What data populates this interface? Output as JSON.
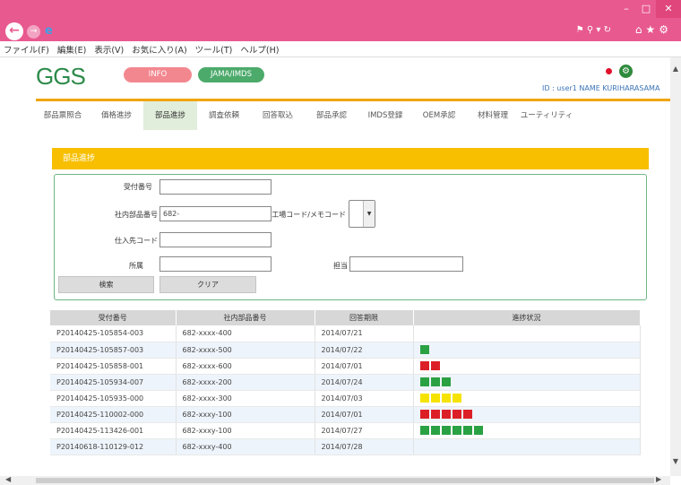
{
  "menubar": [
    "ファイル(F)",
    "編集(E)",
    "表示(V)",
    "お気に入り(A)",
    "ツール(T)",
    "ヘルプ(H)"
  ],
  "header": {
    "logo": "GGS",
    "info_button": "INFO",
    "jama_button": "JAMA/IMDS",
    "user_id": "ID : user1 NAME KURIHARASAMA"
  },
  "tabs": [
    "部品票照合",
    "価格進捗",
    "部品進捗",
    "調査依頼",
    "回答取込",
    "部品承認",
    "IMDS登録",
    "OEM承認",
    "材料管理",
    "ユーティリティ"
  ],
  "active_tab": 2,
  "panel": {
    "title": "部品進捗"
  },
  "form": {
    "receipt_no_label": "受付番号",
    "receipt_no_value": "",
    "part_no_label": "社内部品番号",
    "part_no_value": "682-",
    "factory_code_label": "工場コード/メモコード",
    "supplier_code_label": "仕入先コード",
    "supplier_code_value": "",
    "dept_label": "所属",
    "dept_value": "",
    "person_label": "担当",
    "person_value": "",
    "search_button": "検索",
    "clear_button": "クリア"
  },
  "table": {
    "headers": [
      "受付番号",
      "社内部品番号",
      "回答期限",
      "進捗状況"
    ],
    "rows": [
      {
        "receipt": "P20140425-105854-003",
        "part": "682-xxxx-400",
        "due": "2014/07/21",
        "progress": {
          "color": "",
          "count": 0
        }
      },
      {
        "receipt": "P20140425-105857-003",
        "part": "682-xxxx-500",
        "due": "2014/07/22",
        "progress": {
          "color": "#2aa143",
          "count": 1
        }
      },
      {
        "receipt": "P20140425-105858-001",
        "part": "682-xxxx-600",
        "due": "2014/07/01",
        "progress": {
          "color": "#dc1f26",
          "count": 2
        }
      },
      {
        "receipt": "P20140425-105934-007",
        "part": "682-xxxx-200",
        "due": "2014/07/24",
        "progress": {
          "color": "#2aa143",
          "count": 3
        }
      },
      {
        "receipt": "P20140425-105935-000",
        "part": "682-xxxx-300",
        "due": "2014/07/03",
        "progress": {
          "color": "#f6e300",
          "count": 4
        }
      },
      {
        "receipt": "P20140425-110002-000",
        "part": "682-xxxy-100",
        "due": "2014/07/01",
        "progress": {
          "color": "#dc1f26",
          "count": 5
        }
      },
      {
        "receipt": "P20140425-113426-001",
        "part": "682-xxxy-100",
        "due": "2014/07/27",
        "progress": {
          "color": "#2aa143",
          "count": 6
        }
      },
      {
        "receipt": "P20140618-110129-012",
        "part": "682-xxxy-400",
        "due": "2014/07/28",
        "progress": {
          "color": "",
          "count": 0
        }
      }
    ]
  }
}
